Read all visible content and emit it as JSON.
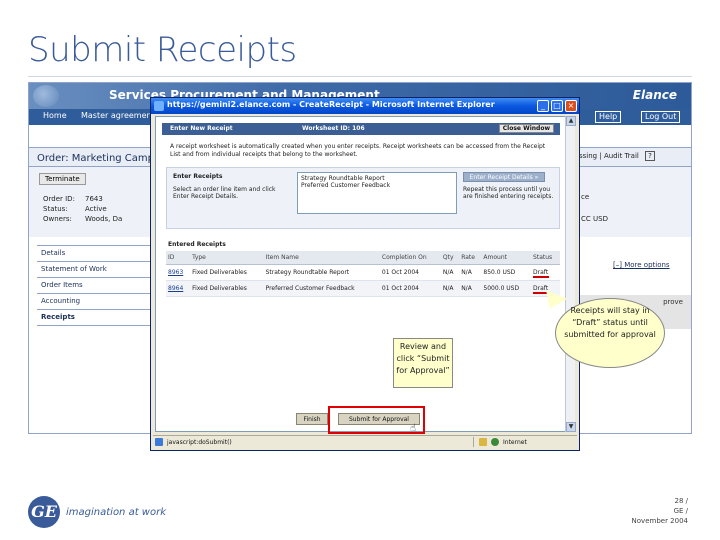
{
  "slide": {
    "title": "Submit Receipts",
    "footer": {
      "page": "28 /",
      "company": "GE /",
      "date": "November 2004"
    },
    "tagline": "imagination at work",
    "logo_text": "GE"
  },
  "app": {
    "name": "Services Procurement and Management",
    "brand": "Elance",
    "nav": {
      "home": "Home",
      "master": "Master agreement",
      "help": "Help",
      "logout": "Log Out"
    },
    "order_title": "Order: Marketing Camp",
    "terminate": "Terminate",
    "fields": [
      {
        "label": "Order ID:",
        "value": "7643"
      },
      {
        "label": "Status:",
        "value": "Active"
      },
      {
        "label": "Owners:",
        "value": "Woods, Da"
      }
    ],
    "menu": [
      "Details",
      "Statement of Work",
      "Order Items",
      "Accounting",
      "Receipts"
    ],
    "right_opts": {
      "a": "ssing",
      "b": "Audit Trail",
      "c": "?"
    },
    "right_misc1": "ce",
    "right_misc2": "CC USD",
    "more_options": {
      "bracket": "[–]",
      "text": "More options"
    },
    "grey_text": "prove"
  },
  "ie": {
    "title": "https://gemini2.elance.com - CreateReceipt - Microsoft Internet Explorer",
    "status_text": "javascript:doSubmit()",
    "zone": "Internet"
  },
  "worksheet": {
    "header": "Enter New Receipt",
    "ws_id": "Worksheet ID: 106",
    "close": "Close Window",
    "desc": "A receipt worksheet is automatically created when you enter receipts. Receipt worksheets can be accessed from the Receipt List and from individual receipts that belong to the worksheet.",
    "enter_heading": "Enter Receipts",
    "enter_instr": "Select an order line item and click Enter Receipt Details.",
    "list_items": [
      "Strategy Roundtable Report",
      "Preferred Customer Feedback"
    ],
    "enter_btn": "Enter Receipt Details »",
    "repeat": "Repeat this process until you are finished entering receipts.",
    "entered_heading": "Entered Receipts",
    "columns": [
      "ID",
      "Type",
      "Item Name",
      "Completion On",
      "Qty",
      "Rate",
      "Amount",
      "Status"
    ],
    "rows": [
      {
        "id": "8963",
        "type": "Fixed Deliverables",
        "item": "Strategy Roundtable Report",
        "completion": "01 Oct 2004",
        "qty": "N/A",
        "rate": "N/A",
        "amount": "850.0 USD",
        "status": "Draft"
      },
      {
        "id": "8964",
        "type": "Fixed Deliverables",
        "item": "Preferred Customer Feedback",
        "completion": "01 Oct 2004",
        "qty": "N/A",
        "rate": "N/A",
        "amount": "5000.0 USD",
        "status": "Draft"
      }
    ],
    "finish": "Finish",
    "submit": "Submit for Approval"
  },
  "callouts": {
    "review": "Review and click “Submit for Approval”",
    "receipts": "Receipts will stay in “Draft” status until submitted for approval"
  }
}
